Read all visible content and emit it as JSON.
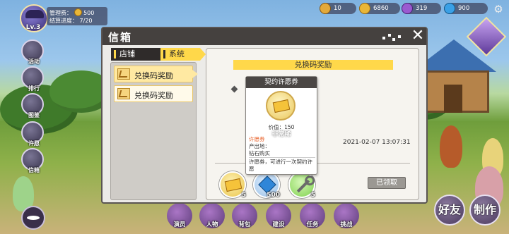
{
  "player": {
    "level": "Lv.3",
    "fee_label": "管理费：",
    "fee_value": "500",
    "progress_label": "结算进度：",
    "progress_value": "7/20"
  },
  "currencies": [
    {
      "name": "amber-coin",
      "value": "10",
      "color": "#e3a93a"
    },
    {
      "name": "gold-coin",
      "value": "6860",
      "color": "#e9b637"
    },
    {
      "name": "purple-orb",
      "value": "319",
      "color": "#9a5ad0"
    },
    {
      "name": "blue-diamond",
      "value": "900",
      "color": "#3aa0e6"
    }
  ],
  "side_menu": [
    "活动",
    "排行",
    "图鉴",
    "许愿",
    "信箱"
  ],
  "bottom_menu": [
    "演员",
    "人物",
    "背包",
    "建设",
    "任务",
    "挑战"
  ],
  "bottom_right": {
    "left": "好友",
    "right": "制作"
  },
  "dialog": {
    "title": "信箱",
    "tabs": {
      "shop": "店铺",
      "system": "系统"
    },
    "mail_items": [
      "兑换码奖励",
      "兑换码奖励"
    ],
    "detail": {
      "title": "兑换码奖励",
      "date": "2021-02-07 13:07:31",
      "claimed_label": "已领取",
      "rewards": [
        {
          "item": "wish-ticket",
          "qty": "5"
        },
        {
          "item": "diamond",
          "qty": "500"
        },
        {
          "item": "contract-key",
          "qty": "5"
        }
      ]
    },
    "tooltip": {
      "title": "契约许愿券",
      "price": "价值：150",
      "rarity": "非常稀",
      "name": "许愿券",
      "source_label": "产出地：",
      "source": "钻石购买",
      "description": "许愿券，可进行一次契约许愿"
    }
  }
}
